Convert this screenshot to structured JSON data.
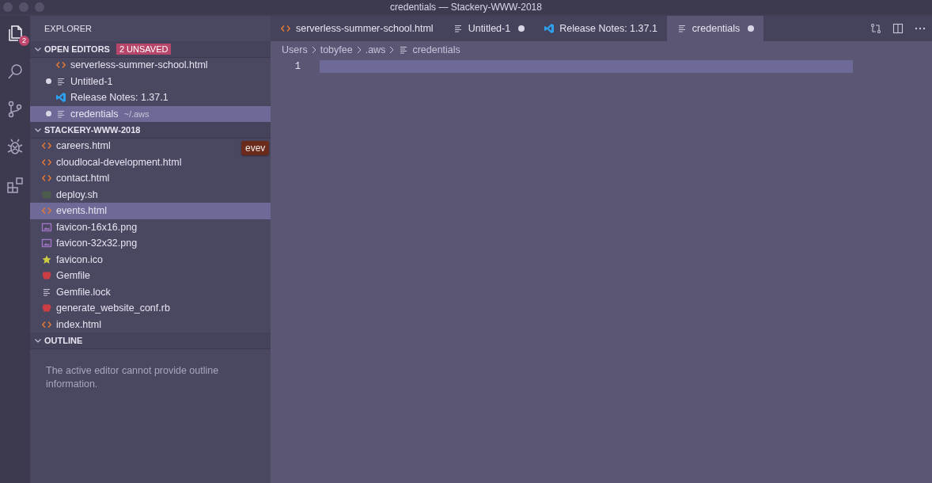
{
  "window": {
    "title": "credentials — Stackery-WWW-2018"
  },
  "activity_bar": [
    {
      "kind": "files",
      "selected": true,
      "badge": "2"
    },
    {
      "kind": "search",
      "selected": false
    },
    {
      "kind": "source-control",
      "selected": false
    },
    {
      "kind": "debug",
      "selected": false
    },
    {
      "kind": "extensions",
      "selected": false
    }
  ],
  "sidebar": {
    "title": "EXPLORER",
    "open_editors": {
      "title": "OPEN EDITORS",
      "badge": "2 UNSAVED",
      "expanded": true,
      "items": [
        {
          "name": "serverless-summer-school.html",
          "kind": "html",
          "dirty": false,
          "selected": false
        },
        {
          "name": "Untitled-1",
          "kind": "text",
          "dirty": true,
          "selected": false
        },
        {
          "name": "Release Notes: 1.37.1",
          "kind": "vscode",
          "dirty": false,
          "selected": false
        },
        {
          "name": "credentials",
          "description": "~/.aws",
          "kind": "text",
          "dirty": true,
          "selected": true
        }
      ]
    },
    "folder": {
      "title": "STACKERY-WWW-2018",
      "expanded": true,
      "items": [
        {
          "name": "careers.html",
          "kind": "html",
          "selected": false
        },
        {
          "name": "cloudlocal-development.html",
          "kind": "html",
          "selected": false
        },
        {
          "name": "contact.html",
          "kind": "html",
          "selected": false
        },
        {
          "name": "deploy.sh",
          "kind": "shell",
          "selected": false
        },
        {
          "name": "events.html",
          "kind": "html",
          "selected": true
        },
        {
          "name": "favicon-16x16.png",
          "kind": "image",
          "selected": false
        },
        {
          "name": "favicon-32x32.png",
          "kind": "image",
          "selected": false
        },
        {
          "name": "favicon.ico",
          "kind": "star",
          "selected": false
        },
        {
          "name": "Gemfile",
          "kind": "ruby",
          "selected": false
        },
        {
          "name": "Gemfile.lock",
          "kind": "text",
          "selected": false
        },
        {
          "name": "generate_website_conf.rb",
          "kind": "ruby",
          "selected": false
        },
        {
          "name": "index.html",
          "kind": "html",
          "selected": false
        }
      ]
    },
    "tooltip": "evev",
    "outline": {
      "title": "OUTLINE",
      "expanded": true,
      "message": "The active editor cannot provide outline information."
    }
  },
  "tabs": [
    {
      "label": "serverless-summer-school.html",
      "kind": "html",
      "dirty": false,
      "selected": false
    },
    {
      "label": "Untitled-1",
      "kind": "text",
      "dirty": true,
      "selected": false
    },
    {
      "label": "Release Notes: 1.37.1",
      "kind": "vscode",
      "dirty": false,
      "selected": false
    },
    {
      "label": "credentials",
      "kind": "text",
      "dirty": true,
      "selected": true
    }
  ],
  "breadcrumbs": [
    {
      "label": "Users",
      "kind": "folder"
    },
    {
      "label": "tobyfee",
      "kind": "folder"
    },
    {
      "label": ".aws",
      "kind": "folder"
    },
    {
      "label": "credentials",
      "kind": "text"
    }
  ],
  "editor": {
    "line_numbers": [
      "1"
    ]
  }
}
